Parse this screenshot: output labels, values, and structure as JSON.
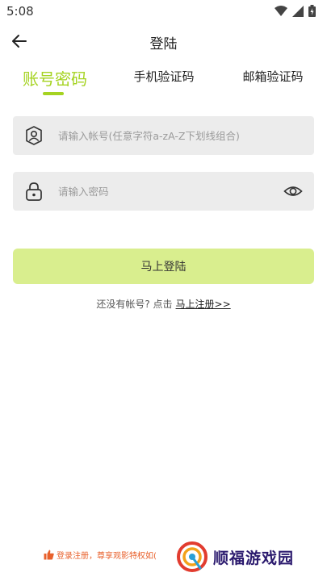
{
  "status": {
    "time": "5:08"
  },
  "header": {
    "title": "登陆"
  },
  "tabs": [
    {
      "label": "账号密码",
      "active": true
    },
    {
      "label": "手机验证码",
      "active": false
    },
    {
      "label": "邮箱验证码",
      "active": false
    }
  ],
  "form": {
    "account_placeholder": "请输入帐号(任意字符a-zA-Z下划线组合)",
    "password_placeholder": "请输入密码"
  },
  "login_button": "马上登陆",
  "register": {
    "prompt": "还没有帐号? 点击",
    "link": "马上注册>>"
  },
  "bottom_note": "登录注册，尊享观影特权如(",
  "brand": {
    "name": "顺福游戏园"
  },
  "colors": {
    "accent": "#a5d321",
    "button": "#d9ee8e",
    "field_bg": "#ececec",
    "note": "#e8612c"
  }
}
